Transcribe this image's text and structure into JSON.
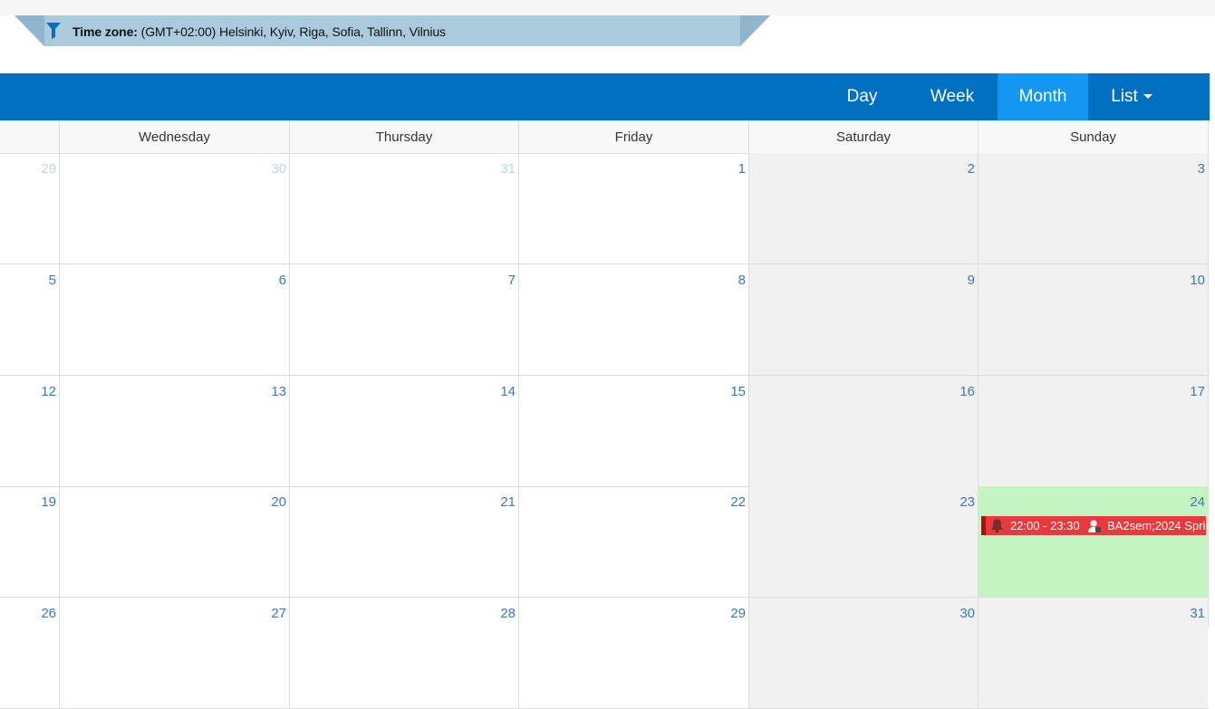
{
  "timezone": {
    "label": "Time zone:",
    "value": "(GMT+02:00) Helsinki, Kyiv, Riga, Sofia, Tallinn, Vilnius",
    "icon": "filter-icon"
  },
  "views": [
    {
      "label": "Day",
      "active": false
    },
    {
      "label": "Week",
      "active": false
    },
    {
      "label": "Month",
      "active": true
    },
    {
      "label": "List",
      "active": false,
      "dropdown": true
    }
  ],
  "weekdays": [
    "Wednesday",
    "Thursday",
    "Friday",
    "Saturday",
    "Sunday"
  ],
  "weeks": [
    [
      {
        "n": "29",
        "other": true
      },
      {
        "n": "30",
        "other": true
      },
      {
        "n": "31",
        "other": true
      },
      {
        "n": "1"
      },
      {
        "n": "2",
        "weekend": true
      },
      {
        "n": "3",
        "weekend": true
      }
    ],
    [
      {
        "n": "5"
      },
      {
        "n": "6"
      },
      {
        "n": "7"
      },
      {
        "n": "8"
      },
      {
        "n": "9",
        "weekend": true
      },
      {
        "n": "10",
        "weekend": true
      }
    ],
    [
      {
        "n": "12"
      },
      {
        "n": "13"
      },
      {
        "n": "14"
      },
      {
        "n": "15"
      },
      {
        "n": "16",
        "weekend": true
      },
      {
        "n": "17",
        "weekend": true
      }
    ],
    [
      {
        "n": "19"
      },
      {
        "n": "20"
      },
      {
        "n": "21"
      },
      {
        "n": "22"
      },
      {
        "n": "23",
        "weekend": true
      },
      {
        "n": "24",
        "today": true
      }
    ],
    [
      {
        "n": "26"
      },
      {
        "n": "27"
      },
      {
        "n": "28"
      },
      {
        "n": "29"
      },
      {
        "n": "30",
        "weekend": true
      },
      {
        "n": "31",
        "weekend": true
      }
    ]
  ],
  "event": {
    "time": "22:00 - 23:30",
    "title": "BA2sem;2024 Spri",
    "icons": [
      "bell-icon",
      "person-icon"
    ]
  },
  "colors": {
    "toolbar": "#0170c1",
    "active_view": "#1397f0",
    "day_number": "#3a79b5",
    "event": "#e8393c",
    "today": "#c4f4c2",
    "banner": "#aacbdd"
  }
}
